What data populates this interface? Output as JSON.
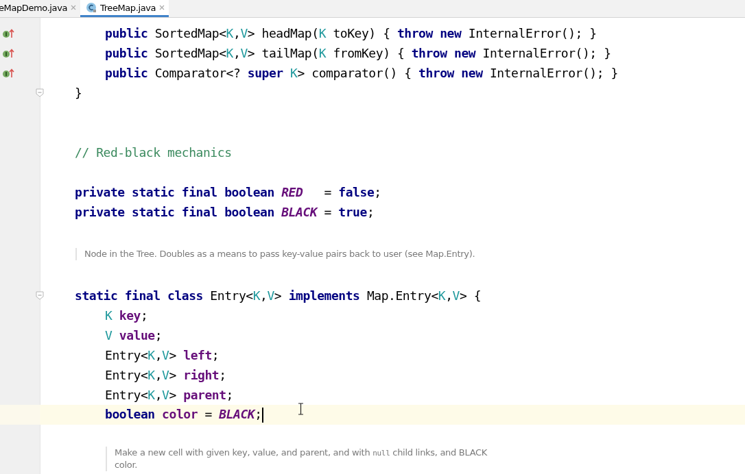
{
  "tabs": [
    {
      "label": "eMapDemo.java",
      "selected": false,
      "kind": "file"
    },
    {
      "label": "TreeMap.java",
      "selected": true,
      "kind": "class"
    }
  ],
  "rows": [
    {
      "kind": "code",
      "indented": true,
      "implements_marker": true,
      "tokens": [
        {
          "kind": "kw",
          "t": "public "
        },
        {
          "kind": "plain",
          "t": "SortedMap<"
        },
        {
          "kind": "type",
          "t": "K"
        },
        {
          "kind": "plain",
          "t": ","
        },
        {
          "kind": "type",
          "t": "V"
        },
        {
          "kind": "plain",
          "t": "> headMap("
        },
        {
          "kind": "type",
          "t": "K"
        },
        {
          "kind": "plain",
          "t": " toKey) { "
        },
        {
          "kind": "kw",
          "t": "throw new "
        },
        {
          "kind": "plain",
          "t": "InternalError(); }"
        }
      ]
    },
    {
      "kind": "code",
      "indented": true,
      "implements_marker": true,
      "tokens": [
        {
          "kind": "kw",
          "t": "public "
        },
        {
          "kind": "plain",
          "t": "SortedMap<"
        },
        {
          "kind": "type",
          "t": "K"
        },
        {
          "kind": "plain",
          "t": ","
        },
        {
          "kind": "type",
          "t": "V"
        },
        {
          "kind": "plain",
          "t": "> tailMap("
        },
        {
          "kind": "type",
          "t": "K"
        },
        {
          "kind": "plain",
          "t": " fromKey) { "
        },
        {
          "kind": "kw",
          "t": "throw new "
        },
        {
          "kind": "plain",
          "t": "InternalError(); }"
        }
      ]
    },
    {
      "kind": "code",
      "indented": true,
      "implements_marker": true,
      "tokens": [
        {
          "kind": "kw",
          "t": "public "
        },
        {
          "kind": "plain",
          "t": "Comparator<? "
        },
        {
          "kind": "kw",
          "t": "super "
        },
        {
          "kind": "type",
          "t": "K"
        },
        {
          "kind": "plain",
          "t": "> comparator() { "
        },
        {
          "kind": "kw",
          "t": "throw new "
        },
        {
          "kind": "plain",
          "t": "InternalError(); }"
        }
      ]
    },
    {
      "kind": "code",
      "fold": true,
      "tokens": [
        {
          "kind": "plain",
          "t": "}"
        }
      ]
    },
    {
      "kind": "blank"
    },
    {
      "kind": "blank"
    },
    {
      "kind": "code",
      "tokens": [
        {
          "kind": "comment",
          "t": "// Red-black mechanics"
        }
      ]
    },
    {
      "kind": "blank"
    },
    {
      "kind": "code",
      "tokens": [
        {
          "kind": "kw",
          "t": "private static final boolean "
        },
        {
          "kind": "const",
          "t": "RED"
        },
        {
          "kind": "plain",
          "t": "   = "
        },
        {
          "kind": "kw",
          "t": "false"
        },
        {
          "kind": "plain",
          "t": ";"
        }
      ]
    },
    {
      "kind": "code",
      "tokens": [
        {
          "kind": "kw",
          "t": "private static final boolean "
        },
        {
          "kind": "const",
          "t": "BLACK"
        },
        {
          "kind": "plain",
          "t": " = "
        },
        {
          "kind": "kw",
          "t": "true"
        },
        {
          "kind": "plain",
          "t": ";"
        }
      ]
    },
    {
      "kind": "doc",
      "indented": false,
      "parts": [
        {
          "kind": "text",
          "t": "Node in the Tree. Doubles as a means to pass key-value pairs back to user (see Map.Entry)."
        }
      ]
    },
    {
      "kind": "code",
      "fold": true,
      "tokens": [
        {
          "kind": "kw",
          "t": "static final class "
        },
        {
          "kind": "plain",
          "t": "Entry<"
        },
        {
          "kind": "type",
          "t": "K"
        },
        {
          "kind": "plain",
          "t": ","
        },
        {
          "kind": "type",
          "t": "V"
        },
        {
          "kind": "plain",
          "t": "> "
        },
        {
          "kind": "kw",
          "t": "implements "
        },
        {
          "kind": "plain",
          "t": "Map.Entry<"
        },
        {
          "kind": "type",
          "t": "K"
        },
        {
          "kind": "plain",
          "t": ","
        },
        {
          "kind": "type",
          "t": "V"
        },
        {
          "kind": "plain",
          "t": "> {"
        }
      ]
    },
    {
      "kind": "code",
      "indented": true,
      "tokens": [
        {
          "kind": "type",
          "t": "K "
        },
        {
          "kind": "field",
          "t": "key"
        },
        {
          "kind": "plain",
          "t": ";"
        }
      ]
    },
    {
      "kind": "code",
      "indented": true,
      "tokens": [
        {
          "kind": "type",
          "t": "V "
        },
        {
          "kind": "field",
          "t": "value"
        },
        {
          "kind": "plain",
          "t": ";"
        }
      ]
    },
    {
      "kind": "code",
      "indented": true,
      "tokens": [
        {
          "kind": "plain",
          "t": "Entry<"
        },
        {
          "kind": "type",
          "t": "K"
        },
        {
          "kind": "plain",
          "t": ","
        },
        {
          "kind": "type",
          "t": "V"
        },
        {
          "kind": "plain",
          "t": "> "
        },
        {
          "kind": "field",
          "t": "left"
        },
        {
          "kind": "plain",
          "t": ";"
        }
      ]
    },
    {
      "kind": "code",
      "indented": true,
      "tokens": [
        {
          "kind": "plain",
          "t": "Entry<"
        },
        {
          "kind": "type",
          "t": "K"
        },
        {
          "kind": "plain",
          "t": ","
        },
        {
          "kind": "type",
          "t": "V"
        },
        {
          "kind": "plain",
          "t": "> "
        },
        {
          "kind": "field",
          "t": "right"
        },
        {
          "kind": "plain",
          "t": ";"
        }
      ]
    },
    {
      "kind": "code",
      "indented": true,
      "tokens": [
        {
          "kind": "plain",
          "t": "Entry<"
        },
        {
          "kind": "type",
          "t": "K"
        },
        {
          "kind": "plain",
          "t": ","
        },
        {
          "kind": "type",
          "t": "V"
        },
        {
          "kind": "plain",
          "t": "> "
        },
        {
          "kind": "field",
          "t": "parent"
        },
        {
          "kind": "plain",
          "t": ";"
        }
      ]
    },
    {
      "kind": "code",
      "indented": true,
      "current": true,
      "tokens": [
        {
          "kind": "kw",
          "t": "boolean "
        },
        {
          "kind": "field",
          "t": "color"
        },
        {
          "kind": "plain",
          "t": " = "
        },
        {
          "kind": "const",
          "t": "BLACK"
        },
        {
          "kind": "plain",
          "t": ";"
        }
      ]
    },
    {
      "kind": "doc",
      "indented": true,
      "parts": [
        {
          "kind": "text",
          "t": "Make a new cell with given key, value, and parent, and with "
        },
        {
          "kind": "code",
          "t": "null"
        },
        {
          "kind": "text",
          "t": " child links, and BLACK color."
        }
      ]
    }
  ]
}
